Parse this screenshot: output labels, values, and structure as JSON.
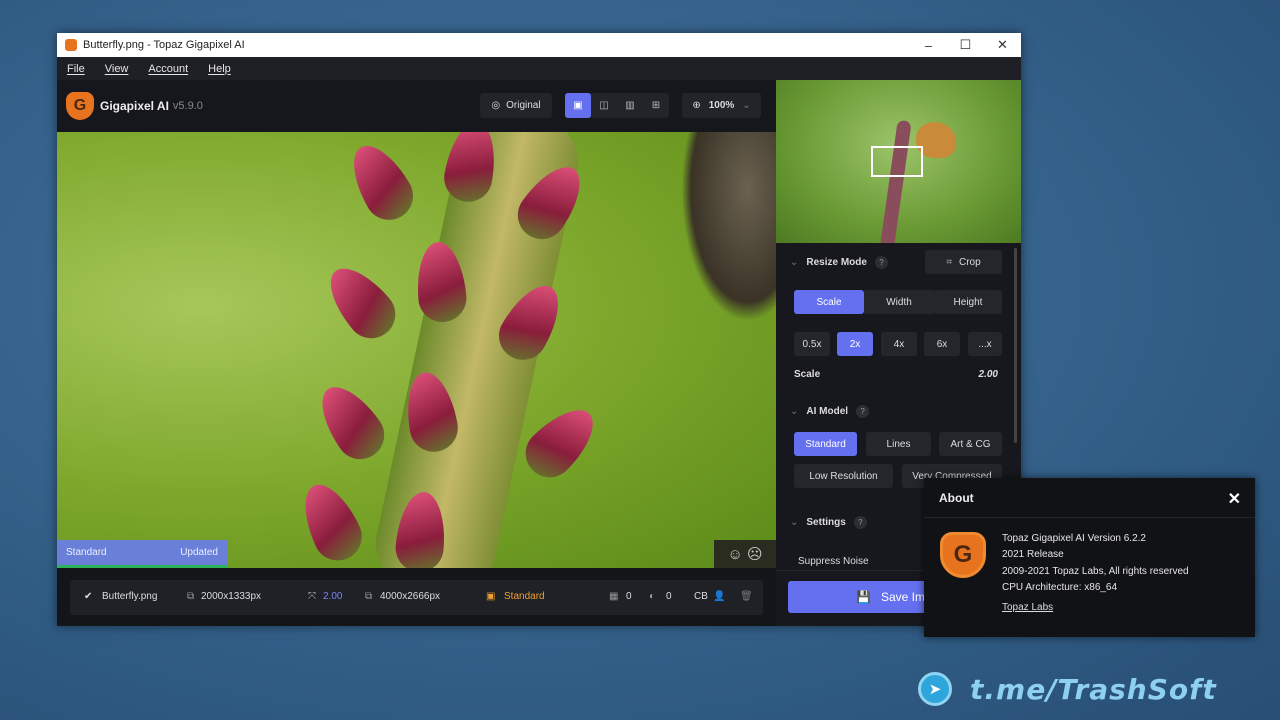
{
  "window": {
    "title": "Butterfly.png - Topaz Gigapixel AI",
    "minimize": "–",
    "maximize": "☐",
    "close": "✕"
  },
  "menu": [
    "File",
    "View",
    "Account",
    "Help"
  ],
  "toolbar": {
    "app_name": "Gigapixel AI",
    "version": "v5.9.0",
    "original_label": "Original",
    "view_modes": [
      "single-view",
      "split-view",
      "side-by-side",
      "quad-view"
    ],
    "zoom": "100%"
  },
  "preview": {
    "model_badge": "Standard",
    "status_badge": "Updated"
  },
  "file_bar": {
    "file_name": "Butterfly.png",
    "input_size": "2000x1333px",
    "scale": "2.00",
    "output_size": "4000x2666px",
    "model": "Standard",
    "noise": "0",
    "blur": "0",
    "face": "CB",
    "accent": "#6470f0",
    "model_color": "#f0a030"
  },
  "panel": {
    "resize_mode": {
      "label": "Resize Mode",
      "help": "?",
      "crop": "Crop",
      "tabs": [
        "Scale",
        "Width",
        "Height"
      ],
      "active_tab": "Scale",
      "presets": [
        "0.5x",
        "2x",
        "4x",
        "6x",
        "...x"
      ],
      "active_preset": "2x",
      "scale_label": "Scale",
      "scale_value": "2.00"
    },
    "ai_model": {
      "label": "AI Model",
      "help": "?",
      "options": [
        "Standard",
        "Lines",
        "Art & CG",
        "Low Resolution",
        "Very Compressed"
      ],
      "active": "Standard"
    },
    "settings": {
      "label": "Settings",
      "help": "?",
      "suppress_noise": "Suppress Noise"
    },
    "save_label": "Save Image"
  },
  "about": {
    "title": "About",
    "close": "✕",
    "lines": [
      "Topaz Gigapixel AI Version 6.2.2",
      "2021 Release",
      "2009-2021 Topaz Labs, All rights reserved",
      "CPU Architecture: x86_64"
    ],
    "link": "Topaz Labs"
  },
  "watermark": "t.me/TrashSoft"
}
